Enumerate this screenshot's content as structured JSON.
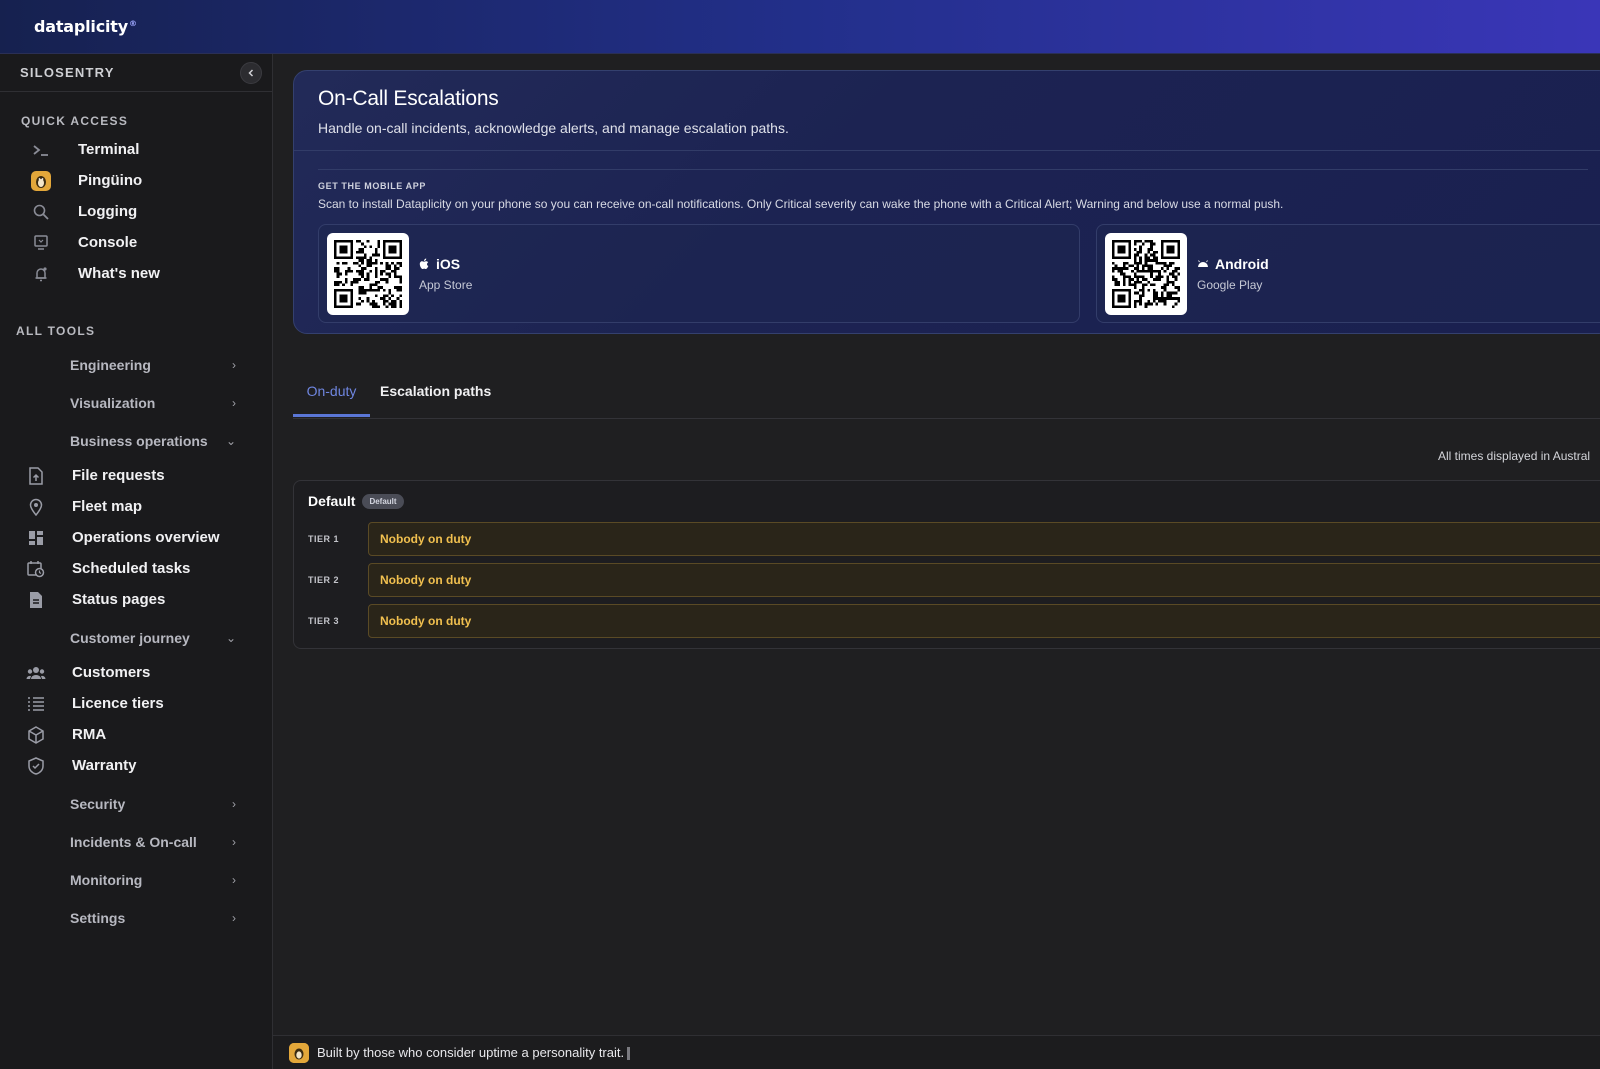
{
  "brand": {
    "name": "dataplicity",
    "mark": "®"
  },
  "sidebar": {
    "org": "SILOSENTRY",
    "collapse_icon": "chevron-left-icon",
    "quick_access_label": "QUICK ACCESS",
    "quick_access": [
      {
        "label": "Terminal",
        "icon": "terminal-icon"
      },
      {
        "label": "Pingüino",
        "icon": "penguin-icon"
      },
      {
        "label": "Logging",
        "icon": "search-icon"
      },
      {
        "label": "Console",
        "icon": "monitor-icon"
      },
      {
        "label": "What's new",
        "icon": "bell-icon"
      }
    ],
    "all_tools_label": "ALL TOOLS",
    "groups": {
      "engineering": "Engineering",
      "visualization": "Visualization",
      "business_operations": "Business operations",
      "customer_journey": "Customer journey",
      "security": "Security",
      "incidents": "Incidents & On-call",
      "monitoring": "Monitoring",
      "settings": "Settings"
    },
    "business_items": [
      {
        "label": "File requests",
        "icon": "file-upload-icon"
      },
      {
        "label": "Fleet map",
        "icon": "map-pin-icon"
      },
      {
        "label": "Operations overview",
        "icon": "dashboard-icon"
      },
      {
        "label": "Scheduled tasks",
        "icon": "calendar-clock-icon"
      },
      {
        "label": "Status pages",
        "icon": "document-icon"
      }
    ],
    "customer_items": [
      {
        "label": "Customers",
        "icon": "people-icon"
      },
      {
        "label": "Licence tiers",
        "icon": "list-icon"
      },
      {
        "label": "RMA",
        "icon": "box-icon"
      },
      {
        "label": "Warranty",
        "icon": "shield-icon"
      }
    ]
  },
  "hero": {
    "title": "On-Call Escalations",
    "subtitle": "Handle on-call incidents, acknowledge alerts, and manage escalation paths.",
    "mobile_label": "GET THE MOBILE APP",
    "mobile_desc": "Scan to install Dataplicity on your phone so you can receive on-call notifications. Only Critical severity can wake the phone with a Critical Alert; Warning and below use a normal push.",
    "ios": {
      "name": "iOS",
      "store": "App Store",
      "icon": "apple-icon"
    },
    "android": {
      "name": "Android",
      "store": "Google Play",
      "icon": "android-icon"
    }
  },
  "tabs": {
    "on_duty": "On-duty",
    "paths": "Escalation paths"
  },
  "tz_note": "All times displayed in Austral",
  "path": {
    "name": "Default",
    "badge": "Default",
    "tiers": [
      {
        "label": "TIER 1",
        "status": "Nobody on duty"
      },
      {
        "label": "TIER 2",
        "status": "Nobody on duty"
      },
      {
        "label": "TIER 3",
        "status": "Nobody on duty"
      }
    ]
  },
  "footer": {
    "text": "Built by those who consider uptime a personality trait."
  },
  "colors": {
    "accent": "#5a76d6",
    "warning": "#f1c04f",
    "pingu": "#e3a73a"
  }
}
